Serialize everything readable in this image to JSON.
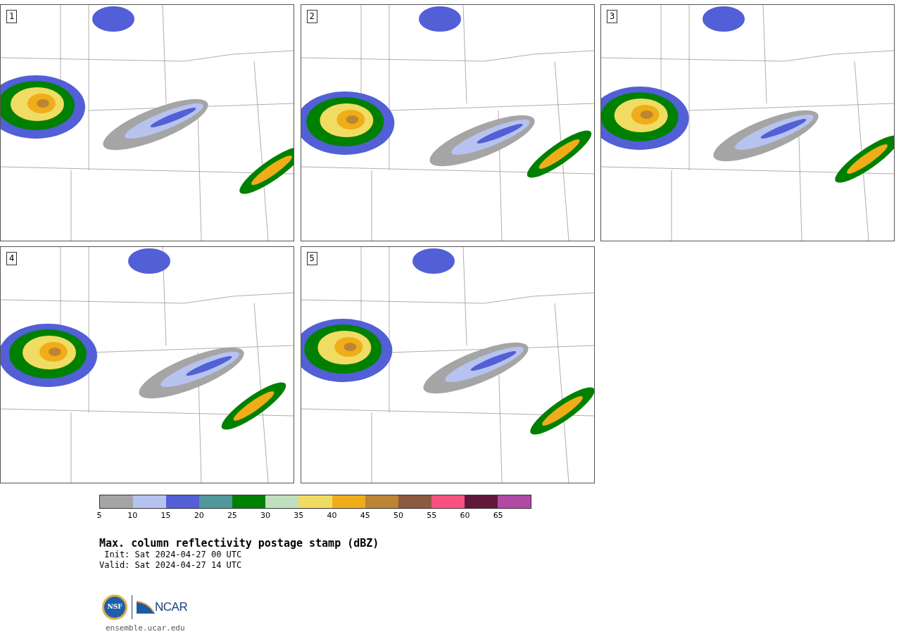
{
  "panels": [
    {
      "label": "1"
    },
    {
      "label": "2"
    },
    {
      "label": "3"
    },
    {
      "label": "4"
    },
    {
      "label": "5"
    }
  ],
  "colorbar": {
    "segments": [
      {
        "color": "#a5a5a5"
      },
      {
        "color": "#b7c3ef"
      },
      {
        "color": "#525fd6"
      },
      {
        "color": "#50989c"
      },
      {
        "color": "#008000"
      },
      {
        "color": "#bfdfbf"
      },
      {
        "color": "#f0dc62"
      },
      {
        "color": "#f0ad1a"
      },
      {
        "color": "#bc8433"
      },
      {
        "color": "#8b5a40"
      },
      {
        "color": "#f7527f"
      },
      {
        "color": "#611839"
      },
      {
        "color": "#b04aa5"
      }
    ],
    "ticks": [
      "5",
      "10",
      "15",
      "20",
      "25",
      "30",
      "35",
      "40",
      "45",
      "50",
      "55",
      "60",
      "65"
    ]
  },
  "title": "Max. column reflectivity postage stamp (dBZ)",
  "init": " Init: Sat 2024-04-27 00 UTC",
  "valid": "Valid: Sat 2024-04-27 14 UTC",
  "logos": {
    "nsf": "NSF",
    "ncar": "NCAR"
  },
  "url": "ensemble.ucar.edu"
}
